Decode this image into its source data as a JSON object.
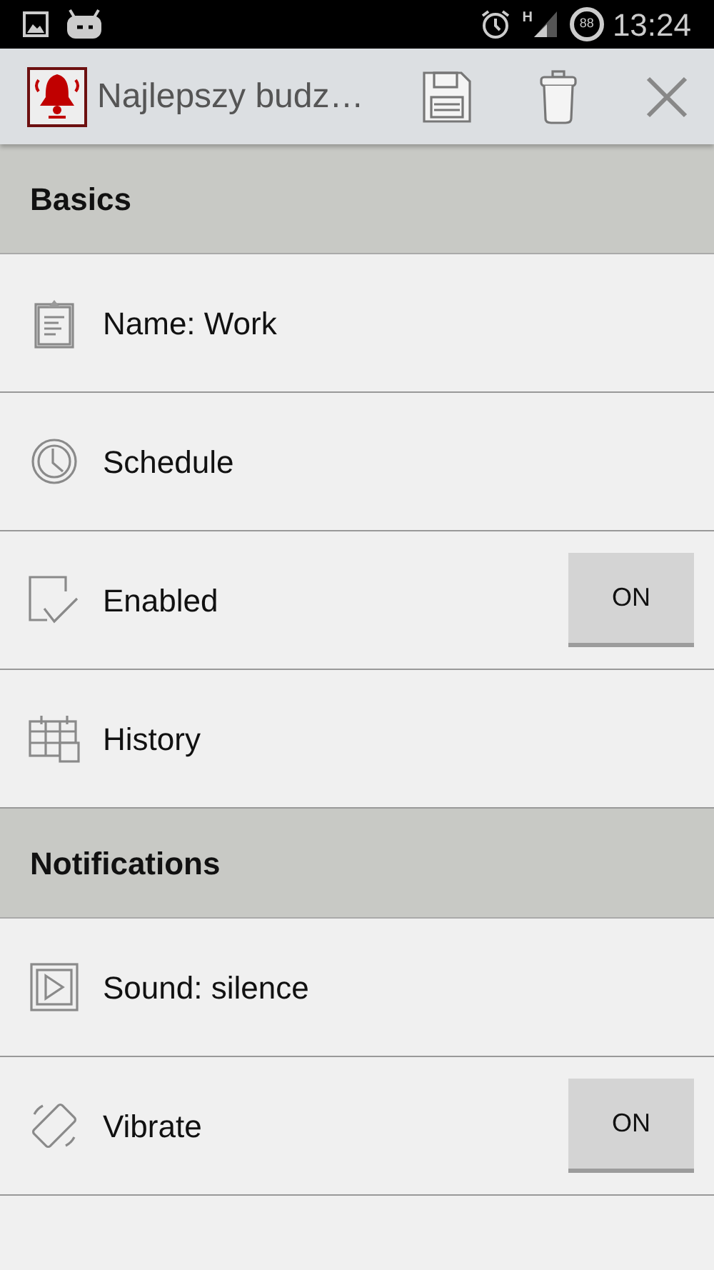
{
  "status_bar": {
    "battery": "88",
    "network": "H",
    "time": "13:24"
  },
  "action_bar": {
    "title": "Najlepszy budz…"
  },
  "sections": [
    {
      "title": "Basics",
      "items": [
        {
          "kind": "text",
          "label": "Name: Work"
        },
        {
          "kind": "text",
          "label": "Schedule"
        },
        {
          "kind": "toggle",
          "label": "Enabled",
          "on": true,
          "button": "ON"
        },
        {
          "kind": "text",
          "label": "History"
        }
      ]
    },
    {
      "title": "Notifications",
      "items": [
        {
          "kind": "text",
          "label": "Sound: silence"
        },
        {
          "kind": "toggle",
          "label": "Vibrate",
          "on": true,
          "button": "ON"
        }
      ]
    }
  ]
}
